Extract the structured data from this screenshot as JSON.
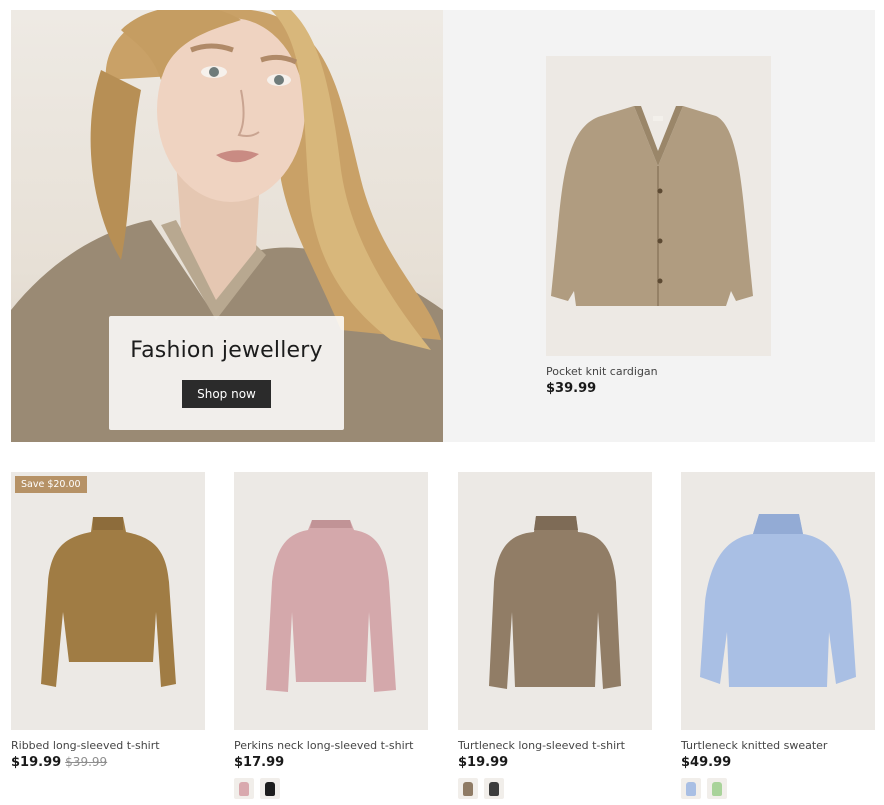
{
  "hero": {
    "title": "Fashion jewellery",
    "cta_label": "Shop now"
  },
  "featured": {
    "name": "Pocket knit cardigan",
    "price": "$39.99",
    "color": "#b09c80"
  },
  "products": [
    {
      "name": "Ribbed long-sleeved t-shirt",
      "price": "$19.99",
      "old_price": "$39.99",
      "badge": "Save $20.00",
      "color": "#a07c44",
      "swatches": []
    },
    {
      "name": "Perkins neck long-sleeved t-shirt",
      "price": "$17.99",
      "color": "#d4a8ab",
      "swatches": [
        "#d9a9ae",
        "#1d1d1d"
      ]
    },
    {
      "name": "Turtleneck long-sleeved t-shirt",
      "price": "$19.99",
      "color": "#917d66",
      "swatches": [
        "#8f7b65",
        "#3c3c3c"
      ]
    },
    {
      "name": "Turtleneck knitted sweater",
      "price": "$49.99",
      "color": "#a9bfe4",
      "swatches": [
        "#a9bfe4",
        "#a9d39a"
      ]
    }
  ]
}
